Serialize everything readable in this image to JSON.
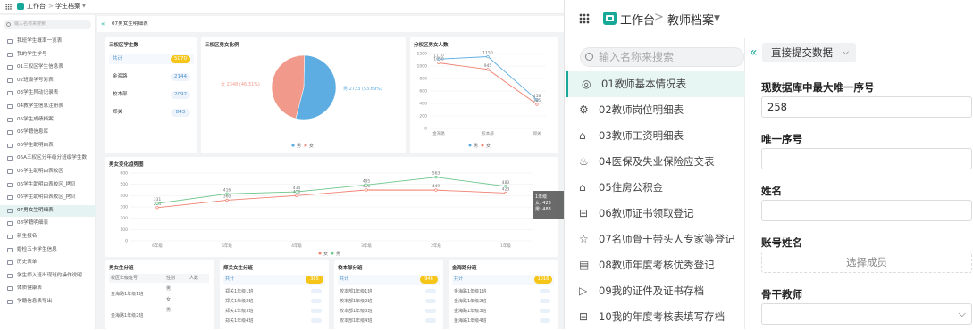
{
  "left": {
    "topbar": {
      "app": "工作台",
      "sep": ">",
      "module": "学生档案"
    },
    "search_placeholder": "输入名称来搜索",
    "page_title": "07男女生明细表",
    "sidebar": [
      "我班学生概率一览表",
      "我的学生学号",
      "01三权区学生信息表",
      "02班级学号对表",
      "03学生异动记录表",
      "04教学生信息注册表",
      "05学生成绩档案",
      "06学籍信息库",
      "06学生助明由表",
      "06A三权区分年级分班级学生数",
      "06学生助明由表校区",
      "06学生助明由表校区_拷贝",
      "06学生助明由表校区_拷贝",
      "07男女生明细表",
      "08学籍明细表",
      "新生报名",
      "婚检五卡学生信息",
      "历史表单",
      "学生师入班出现班约操作说明",
      "体质健康表",
      "学籍信息表导出"
    ],
    "stat_card": {
      "title": "三权区学生数",
      "rows": [
        {
          "label": "共计",
          "value": "5070"
        },
        {
          "label": "金海路",
          "value": "2144"
        },
        {
          "label": "校本部",
          "value": "2092"
        },
        {
          "label": "郑关",
          "value": "843"
        }
      ]
    },
    "pie_card": {
      "title": "三权区男女比例",
      "legend": [
        "男",
        "女"
      ],
      "male_label": "男 2723 (53.69%)",
      "female_label": "女 2348 (46.31%)"
    },
    "bar_card": {
      "title": "分权区男女人数",
      "legend": [
        "男",
        "女"
      ]
    },
    "line_card": {
      "title": "男女变化趋势图",
      "legend": [
        "女",
        "男"
      ],
      "tooltip": {
        "title": "1年级",
        "female": "女: 423",
        "male": "男: 483"
      }
    },
    "bottom_cards": [
      {
        "title": "男女生分班",
        "headers": [
          "校区年级班号",
          "性别",
          "人数"
        ],
        "rows": [
          "金海路1年级1班",
          "金海路1年级2班"
        ],
        "genders": [
          "男",
          "女",
          "男"
        ]
      },
      {
        "title": "郑关女生分班",
        "total_label": "共计",
        "total": "385",
        "rows": [
          "郑关1年级1班",
          "郑关1年级2班",
          "郑关1年级3班",
          "郑关1年级4班"
        ]
      },
      {
        "title": "校本部分班",
        "total_label": "共计",
        "total": "946",
        "rows": [
          "校本部1年级1班",
          "校本部1年级2班",
          "校本部1年级3班",
          "校本部1年级4班"
        ]
      },
      {
        "title": "金海路分班",
        "total_label": "共计",
        "total": "1016",
        "rows": [
          "金海路1年级1班",
          "金海路1年级2班",
          "金海路1年级3班",
          "金海路1年级4班"
        ]
      }
    ]
  },
  "chart_data": [
    {
      "type": "pie",
      "title": "三权区男女比例",
      "categories": [
        "男",
        "女"
      ],
      "values": [
        2723,
        2348
      ],
      "labels": [
        "男 2723 (53.69%)",
        "女 2348 (46.31%)"
      ]
    },
    {
      "type": "line",
      "title": "分权区男女人数",
      "categories": [
        "金海路",
        "校本部",
        "郑关"
      ],
      "series": [
        {
          "name": "男",
          "values": [
            1110,
            1150,
            458
          ]
        },
        {
          "name": "女",
          "values": [
            1050,
            945,
            385
          ]
        }
      ],
      "ylim": [
        0,
        1200
      ],
      "yticks": [
        0,
        200,
        400,
        600,
        800,
        1000,
        1200
      ]
    },
    {
      "type": "line",
      "title": "男女变化趋势图",
      "categories": [
        "6年级",
        "5年级",
        "4年级",
        "3年级",
        "2年级",
        "1年级"
      ],
      "series": [
        {
          "name": "女",
          "values": [
            294,
            360,
            400,
            450,
            449,
            423
          ]
        },
        {
          "name": "男",
          "values": [
            331,
            416,
            434,
            495,
            563,
            483
          ]
        }
      ],
      "ylim": [
        0,
        600
      ],
      "yticks": [
        0,
        100,
        200,
        300,
        400,
        500,
        600
      ]
    }
  ],
  "right": {
    "topbar": {
      "app": "工作台",
      "sep": ">",
      "module": "教师档案"
    },
    "search_placeholder": "输入名称来搜索",
    "view_select": "直接提交数据",
    "sidebar": [
      "01教师基本情况表",
      "02教师岗位明细表",
      "03教师工资明细表",
      "04医保及失业保险应交表",
      "05住房公积金",
      "06教师证书领取登记",
      "07名师骨干带头人专家等登记",
      "08教师年度考核优秀登记",
      "09我的证件及证书存档",
      "10我的年度考核表填写存档"
    ],
    "form": {
      "f1_label": "现数据库中最大唯一序号",
      "f1_value": "258",
      "f2_label": "唯一序号",
      "f3_label": "姓名",
      "f4_label": "账号姓名",
      "f4_button": "选择成员",
      "f5_label": "骨干教师"
    }
  }
}
